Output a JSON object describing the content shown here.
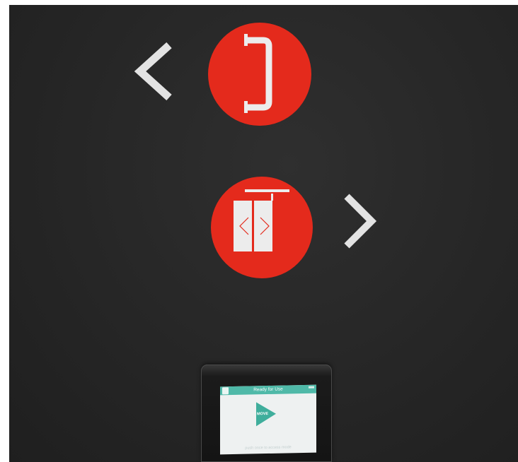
{
  "scene": {
    "wall_color": "#262626",
    "sign_color": "#e42a1c",
    "glyph_color": "#e3e3e3",
    "icons": [
      "chevron-left-icon",
      "door-handle-icon",
      "sliding-door-icon",
      "chevron-right-icon"
    ]
  },
  "device": {
    "title": "Ready for Use",
    "button_label": "MOVE",
    "hint": "push once to access mode",
    "accent_color": "#4fb9a8"
  }
}
